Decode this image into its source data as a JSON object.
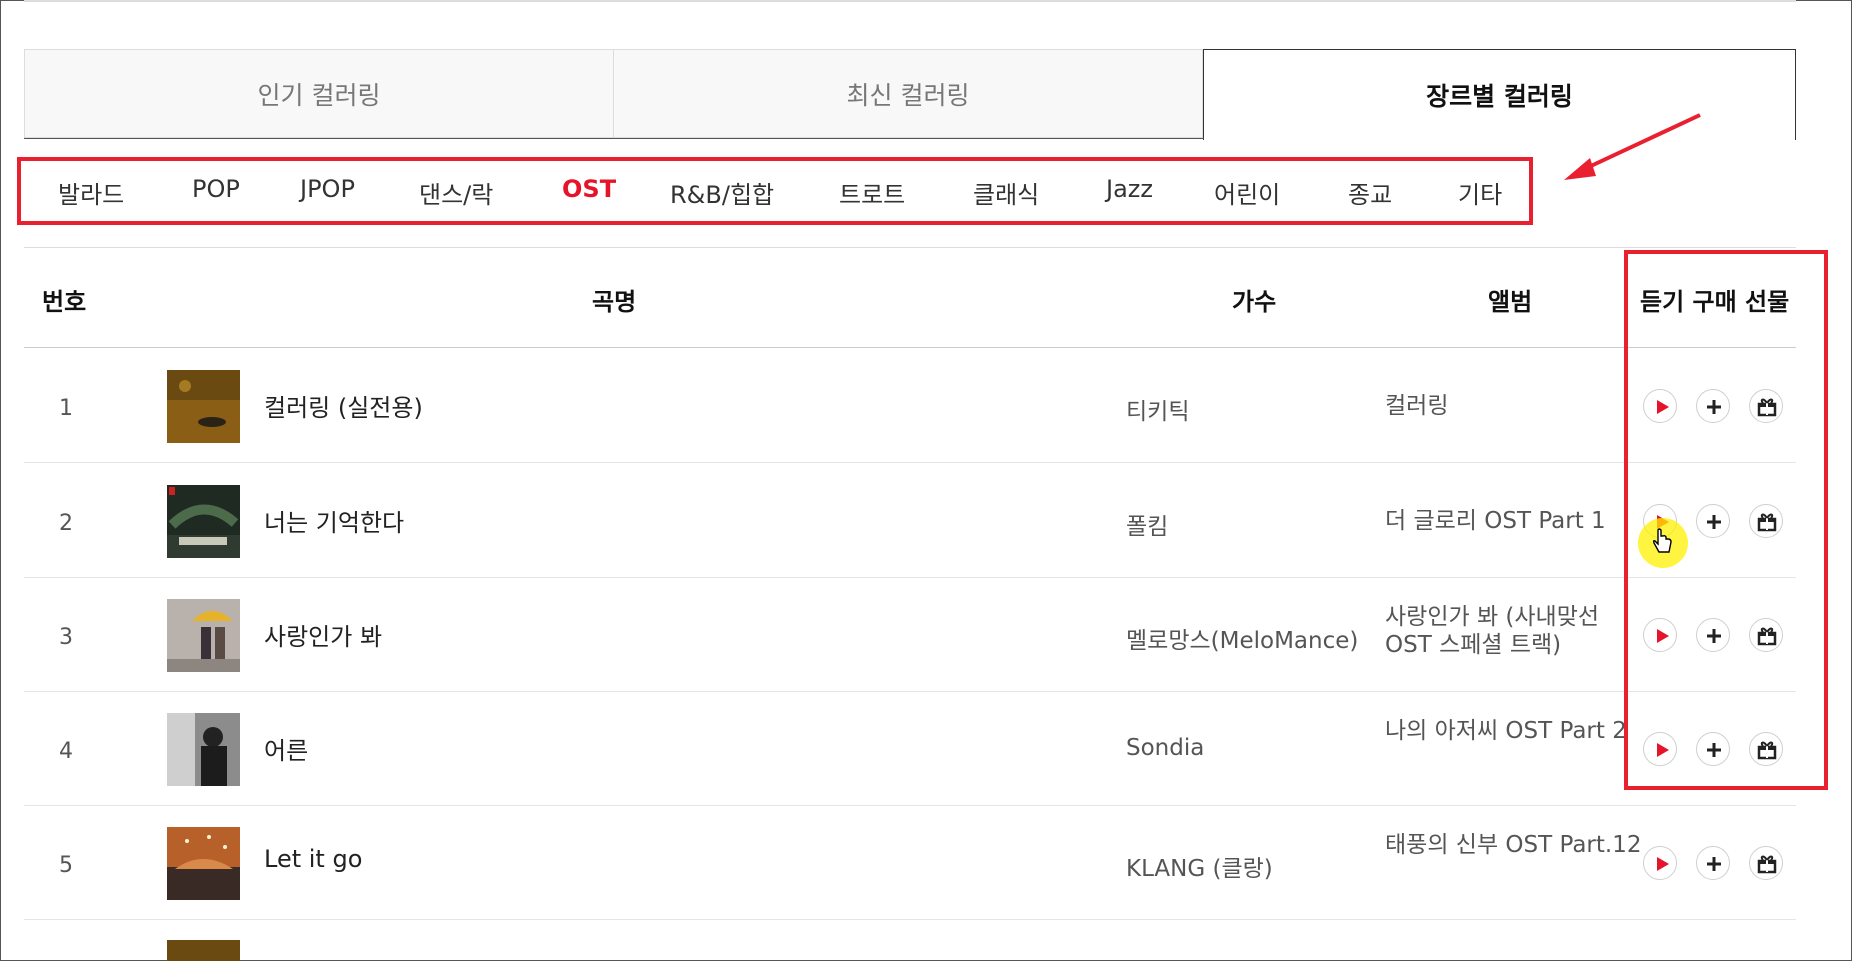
{
  "tabs": [
    {
      "label": "인기 컬러링",
      "active": false
    },
    {
      "label": "최신 컬러링",
      "active": false
    },
    {
      "label": "장르별 컬러링",
      "active": true
    }
  ],
  "genres": [
    "발라드",
    "POP",
    "JPOP",
    "댄스/락",
    "OST",
    "R&B/힙합",
    "트로트",
    "클래식",
    "Jazz",
    "어린이",
    "종교",
    "기타"
  ],
  "active_genre": "OST",
  "table": {
    "headers": {
      "number": "번호",
      "title": "곡명",
      "artist": "가수",
      "album": "앨범",
      "actions": "듣기 구매 선물"
    },
    "rows": [
      {
        "number": "1",
        "title": "컬러링 (실전용)",
        "artist": "티키틱",
        "album": "컬러링"
      },
      {
        "number": "2",
        "title": "너는 기억한다",
        "artist": "폴킴",
        "album": "더 글로리 OST Part 1"
      },
      {
        "number": "3",
        "title": "사랑인가 봐",
        "artist": "멜로망스(MeloMance)",
        "album": "사랑인가 봐 (사내맞선 OST 스페셜 트랙)"
      },
      {
        "number": "4",
        "title": "어른",
        "artist": "Sondia",
        "album": "나의 아저씨 OST Part 2"
      },
      {
        "number": "5",
        "title": "Let it go",
        "artist": "KLANG (클랑)",
        "album": "태풍의 신부 OST Part.12"
      }
    ]
  },
  "icons": {
    "play": "play-icon",
    "add": "plus-icon",
    "gift": "gift-icon"
  },
  "colors": {
    "accent": "#e5142a",
    "highlight_box": "#e8202f"
  }
}
